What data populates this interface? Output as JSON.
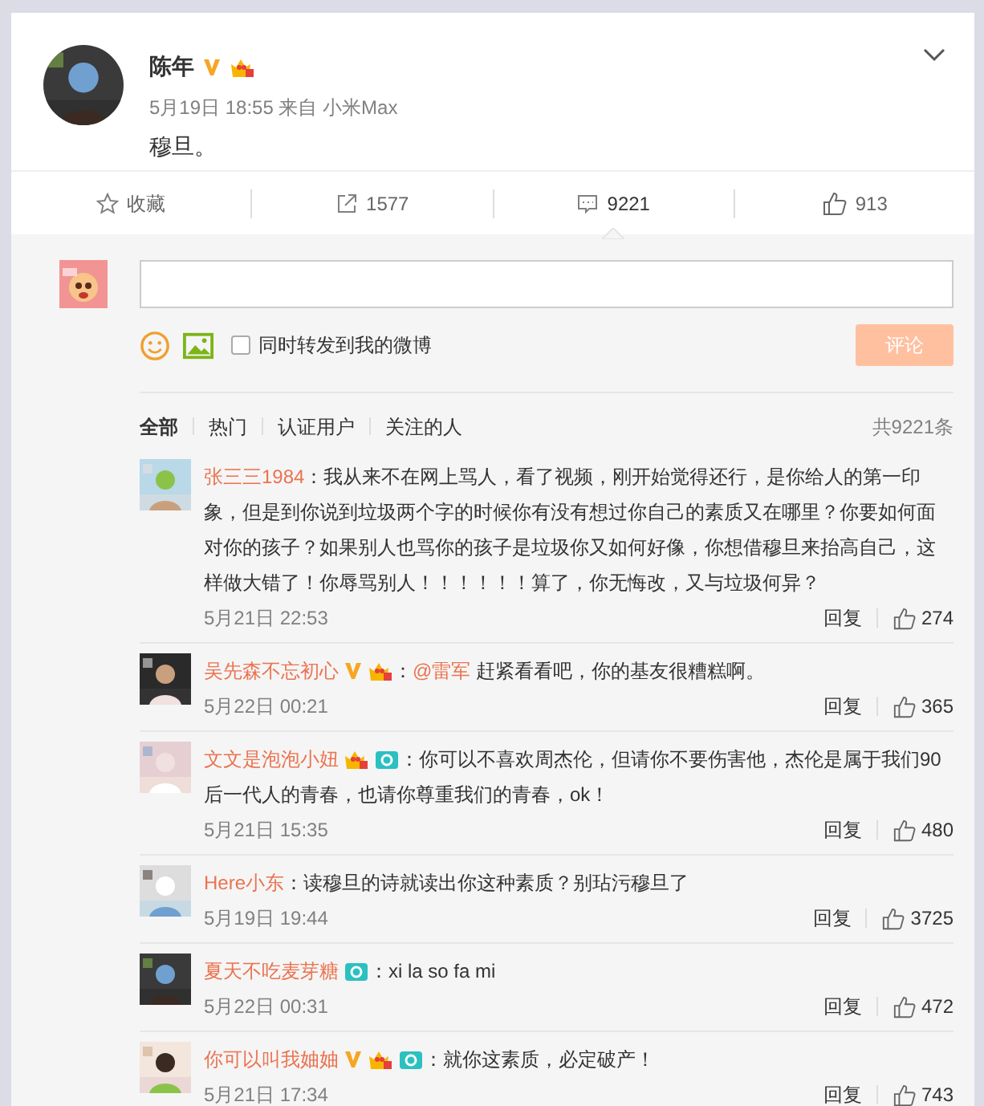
{
  "post": {
    "author": "陈年",
    "badges": [
      {
        "kind": "verified"
      },
      {
        "kind": "crown"
      }
    ],
    "meta": "5月19日 18:55 来自 小米Max",
    "text": "穆旦。"
  },
  "actions": [
    {
      "kind": "favorite",
      "label": "收藏",
      "selected": false
    },
    {
      "kind": "repost",
      "label": "1577",
      "selected": false
    },
    {
      "kind": "comment",
      "label": "9221",
      "selected": true
    },
    {
      "kind": "like",
      "label": "913",
      "selected": false
    }
  ],
  "composer": {
    "also_repost": {
      "label": "同时转发到我的微博",
      "checked": false
    },
    "submit": {
      "label": "评论",
      "disabled": true
    }
  },
  "filters": [
    {
      "label": "全部",
      "selected": true
    },
    {
      "label": "热门",
      "selected": false
    },
    {
      "label": "认证用户",
      "selected": false
    },
    {
      "label": "关注的人",
      "selected": false
    }
  ],
  "total": "共9221条",
  "comments": [
    {
      "name": "张三三1984",
      "text": "：我从来不在网上骂人，看了视频，刚开始觉得还行，是你给人的第一印象，但是到你说到垃圾两个字的时候你有没有想过你自己的素质又在哪里？你要如何面对你的孩子？如果别人也骂你的孩子是垃圾你又如何好像，你想借穆旦来抬高自己，这样做大错了！你辱骂别人！！！！！！算了，你无悔改，又与垃圾何异？",
      "time": "5月21日 22:53",
      "reply": "回复",
      "likes": "274"
    },
    {
      "name": "吴先森不忘初心",
      "badges": [
        {
          "kind": "verified"
        },
        {
          "kind": "crown"
        }
      ],
      "lead": "：",
      "mention": "@雷军",
      "text": " 赶紧看看吧，你的基友很糟糕啊。",
      "time": "5月22日 00:21",
      "reply": "回复",
      "likes": "365"
    },
    {
      "name": "文文是泡泡小妞",
      "badges": [
        {
          "kind": "crown"
        },
        {
          "kind": "camera"
        }
      ],
      "text": "：你可以不喜欢周杰伦，但请你不要伤害他，杰伦是属于我们90后一代人的青春，也请你尊重我们的青春，ok！",
      "time": "5月21日 15:35",
      "reply": "回复",
      "likes": "480"
    },
    {
      "name": "Here小东",
      "text": "：读穆旦的诗就读出你这种素质？别玷污穆旦了",
      "time": "5月19日 19:44",
      "reply": "回复",
      "likes": "3725"
    },
    {
      "name": "夏天不吃麦芽糖",
      "badges": [
        {
          "kind": "camera"
        }
      ],
      "text": "：xi la so fa mi",
      "time": "5月22日 00:31",
      "reply": "回复",
      "likes": "472"
    },
    {
      "name": "你可以叫我妯妯",
      "badges": [
        {
          "kind": "verified"
        },
        {
          "kind": "crown"
        },
        {
          "kind": "camera"
        }
      ],
      "text": "：就你这素质，必定破产！",
      "time": "5月21日 17:34",
      "reply": "回复",
      "likes": "743"
    }
  ]
}
